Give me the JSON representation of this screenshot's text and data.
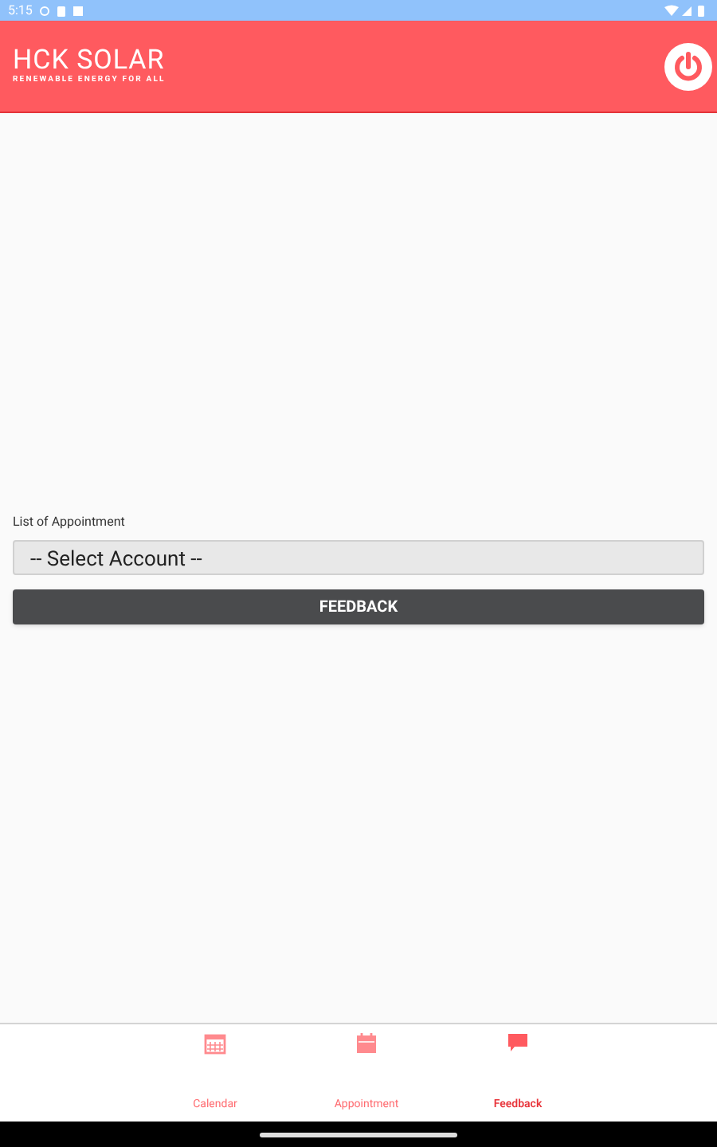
{
  "status_bar": {
    "time": "5:15"
  },
  "header": {
    "logo_title": "HCK SOLAR",
    "logo_tagline": "RENEWABLE ENERGY FOR ALL"
  },
  "form": {
    "label": "List of Appointment",
    "select_value": "-- Select Account --",
    "button": "FEEDBACK"
  },
  "tabs": [
    {
      "kind": "calendar",
      "label": "Calendar",
      "selected": false
    },
    {
      "kind": "appointment",
      "label": "Appointment",
      "selected": false
    },
    {
      "kind": "feedback",
      "label": "Feedback",
      "selected": true
    }
  ]
}
